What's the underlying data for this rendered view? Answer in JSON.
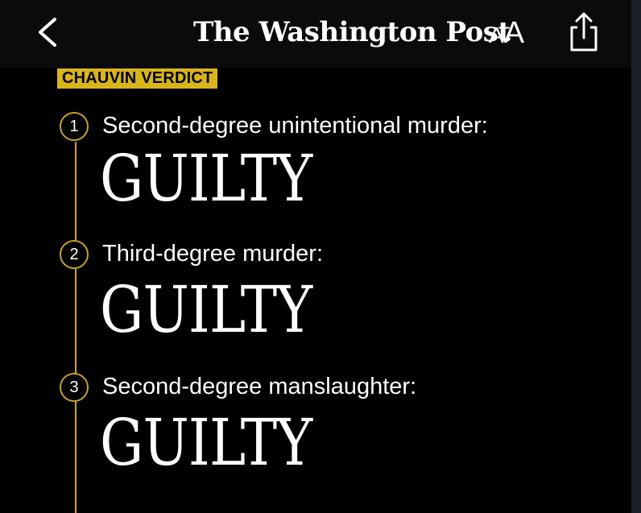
{
  "header": {
    "masthead": "The Washington Post",
    "text_size_small": "A",
    "text_size_large": "A"
  },
  "article": {
    "kicker": "CHAUVIN VERDICT",
    "charges": [
      {
        "number": "1",
        "label": "Second-degree unintentional murder:",
        "verdict": "GUILTY"
      },
      {
        "number": "2",
        "label": "Third-degree murder:",
        "verdict": "GUILTY"
      },
      {
        "number": "3",
        "label": "Second-degree manslaughter:",
        "verdict": "GUILTY"
      }
    ]
  },
  "icons": {
    "back": "chevron-left-icon",
    "share": "share-icon"
  },
  "colors": {
    "background": "#000000",
    "accent_gold": "#c9a227",
    "kicker_bg": "#d9b51c",
    "text": "#ffffff"
  }
}
